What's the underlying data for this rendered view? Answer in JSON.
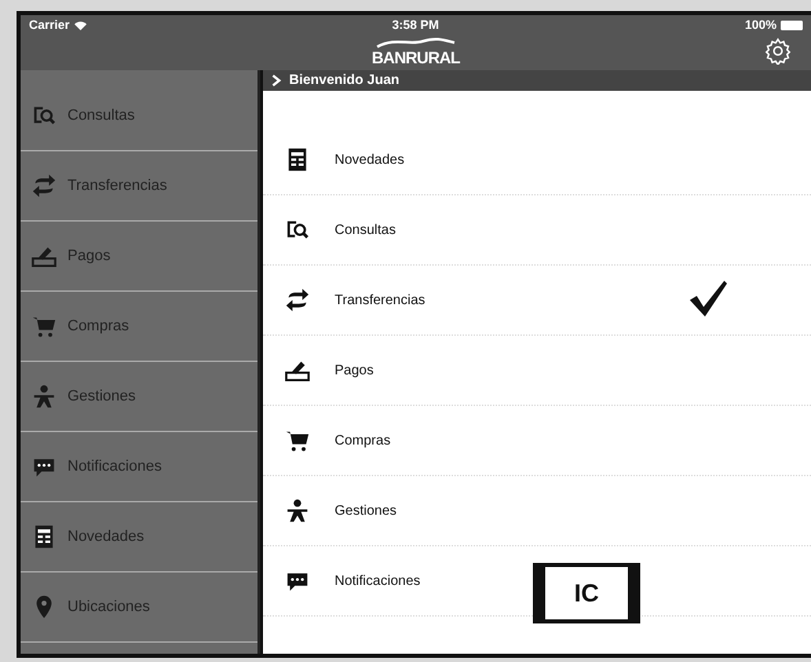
{
  "status_bar": {
    "carrier": "Carrier",
    "time": "3:58 PM",
    "battery": "100%"
  },
  "header": {
    "logo": "BANRURAL"
  },
  "sidebar": {
    "items": [
      {
        "label": "Consultas",
        "kind": "search"
      },
      {
        "label": "Transferencias",
        "kind": "transfer"
      },
      {
        "label": "Pagos",
        "kind": "pay"
      },
      {
        "label": "Compras",
        "kind": "cart"
      },
      {
        "label": "Gestiones",
        "kind": "person"
      },
      {
        "label": "Notificaciones",
        "kind": "chat"
      },
      {
        "label": "Novedades",
        "kind": "news"
      },
      {
        "label": "Ubicaciones",
        "kind": "pin"
      }
    ]
  },
  "content": {
    "breadcrumb": "Bienvenido Juan",
    "rows": [
      {
        "label": "Novedades",
        "kind": "news",
        "checked": false
      },
      {
        "label": "Consultas",
        "kind": "search",
        "checked": false
      },
      {
        "label": "Transferencias",
        "kind": "transfer",
        "checked": true
      },
      {
        "label": "Pagos",
        "kind": "pay",
        "checked": false
      },
      {
        "label": "Compras",
        "kind": "cart",
        "checked": false
      },
      {
        "label": "Gestiones",
        "kind": "person",
        "checked": false
      },
      {
        "label": "Notificaciones",
        "kind": "chat",
        "checked": false
      }
    ]
  },
  "annotation": {
    "label": "IC"
  }
}
